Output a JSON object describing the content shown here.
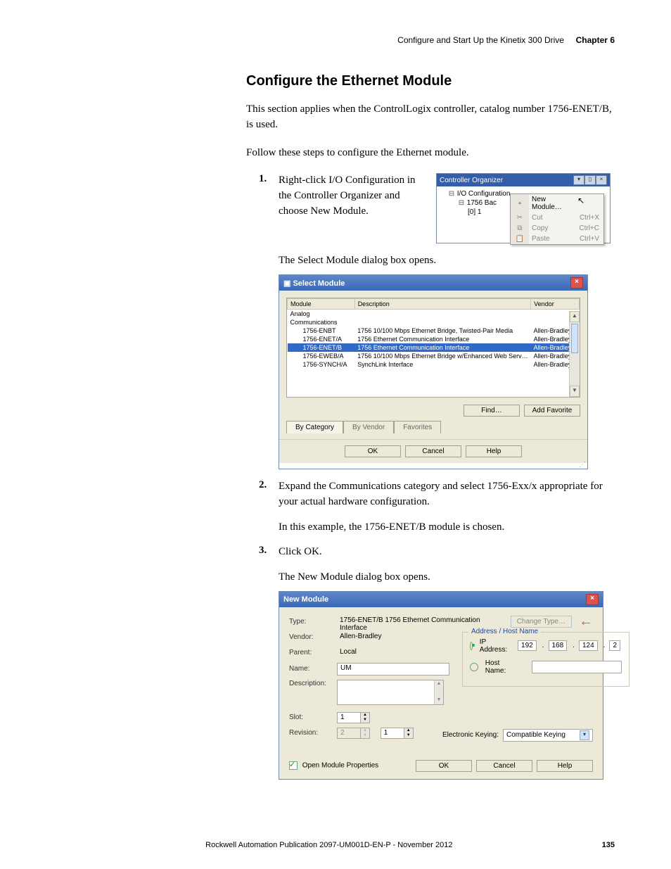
{
  "header": {
    "title": "Configure and Start Up the Kinetix 300 Drive",
    "chapter": "Chapter 6"
  },
  "section_title": "Configure the Ethernet Module",
  "intro1": "This section applies when the ControlLogix controller, catalog number 1756-ENET/B, is used.",
  "intro2": "Follow these steps to configure the Ethernet module.",
  "steps": {
    "s1": {
      "num": "1.",
      "text": "Right-click I/O Configuration in the Controller Organizer and choose New Module."
    },
    "s1_sub": "The Select Module dialog box opens.",
    "s2": {
      "num": "2.",
      "text": "Expand the Communications category and select 1756-Exx/x appropriate for your actual hardware configuration."
    },
    "s2_sub": "In this example, the 1756-ENET/B module is chosen.",
    "s3": {
      "num": "3.",
      "text": "Click OK."
    },
    "s3_sub": "The New Module dialog box opens."
  },
  "ctrl_org": {
    "title": "Controller Organizer",
    "tree": {
      "root": "I/O Configuration",
      "child1": "1756 Bac",
      "child2": "[0] 1"
    },
    "menu": {
      "new_module": "New Module…",
      "cut": "Cut",
      "cut_sc": "Ctrl+X",
      "copy": "Copy",
      "copy_sc": "Ctrl+C",
      "paste": "Paste",
      "paste_sc": "Ctrl+V"
    }
  },
  "sel_mod": {
    "title": "Select Module",
    "cols": {
      "module": "Module",
      "desc": "Description",
      "vendor": "Vendor"
    },
    "cat1": "Analog",
    "cat2": "Communications",
    "rows": [
      {
        "m": "1756-ENBT",
        "d": "1756 10/100 Mbps Ethernet Bridge, Twisted-Pair Media",
        "v": "Allen-Bradley"
      },
      {
        "m": "1756-ENET/A",
        "d": "1756 Ethernet Communication Interface",
        "v": "Allen-Bradley"
      },
      {
        "m": "1756-ENET/B",
        "d": "1756 Ethernet Communication Interface",
        "v": "Allen-Bradley",
        "sel": true
      },
      {
        "m": "1756-EWEB/A",
        "d": "1756 10/100 Mbps Ethernet Bridge w/Enhanced Web Serv…",
        "v": "Allen-Bradley"
      },
      {
        "m": "1756-SYNCH/A",
        "d": "SynchLink Interface",
        "v": "Allen-Bradley"
      }
    ],
    "find": "Find…",
    "add_fav": "Add Favorite",
    "tabs": {
      "by_cat": "By Category",
      "by_vendor": "By Vendor",
      "fav": "Favorites"
    },
    "ok": "OK",
    "cancel": "Cancel",
    "help": "Help"
  },
  "new_mod": {
    "title": "New Module",
    "type_label": "Type:",
    "type_val": "1756-ENET/B 1756 Ethernet Communication Interface",
    "change_type": "Change Type…",
    "vendor_label": "Vendor:",
    "vendor_val": "Allen-Bradley",
    "parent_label": "Parent:",
    "parent_val": "Local",
    "name_label": "Name:",
    "name_val": "UM",
    "desc_label": "Description:",
    "slot_label": "Slot:",
    "slot_val": "1",
    "rev_label": "Revision:",
    "rev_major": "2",
    "rev_minor": "1",
    "addr_legend": "Address / Host Name",
    "ip_label": "IP Address:",
    "ip": {
      "a": "192",
      "b": "168",
      "c": "124",
      "d": "2"
    },
    "host_label": "Host Name:",
    "ek_label": "Electronic Keying:",
    "ek_val": "Compatible Keying",
    "open_props": "Open Module Properties",
    "ok": "OK",
    "cancel": "Cancel",
    "help": "Help"
  },
  "footer": {
    "pub": "Rockwell Automation Publication 2097-UM001D-EN-P - November 2012",
    "page": "135"
  }
}
